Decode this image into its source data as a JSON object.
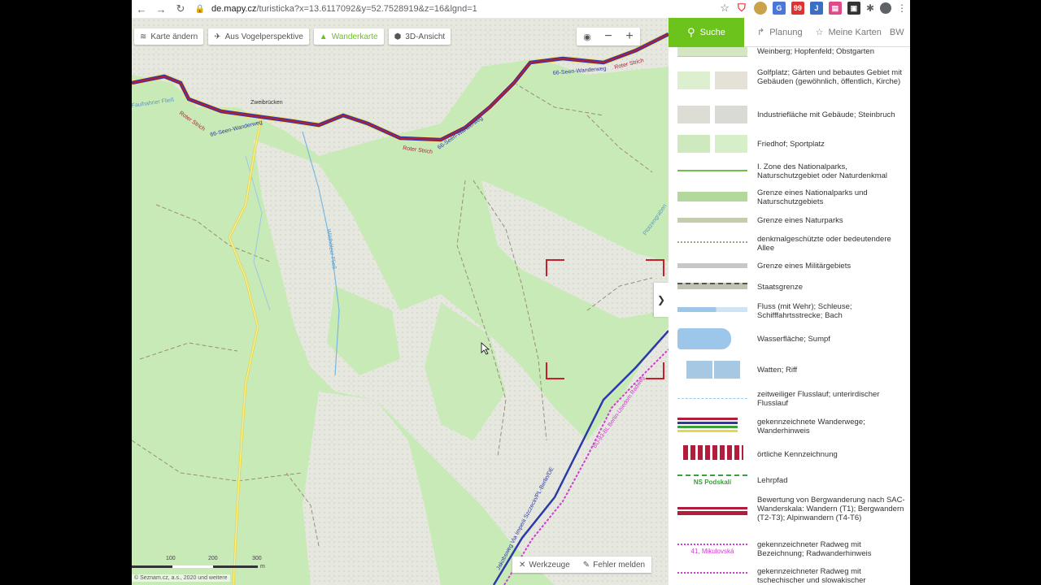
{
  "browser": {
    "url_host": "de.mapy.cz",
    "url_path": "/turisticka?x=13.6117092&y=52.7528919&z=16&lgnd=1"
  },
  "toolbar": {
    "change_map": "Karte ändern",
    "birds_eye": "Aus Vogelperspektive",
    "hiking_map": "Wanderkarte",
    "view_3d": "3D-Ansicht"
  },
  "header": {
    "search": "Suche",
    "planning": "Planung",
    "my_maps": "Meine Karten",
    "user": "BW"
  },
  "map_labels": {
    "village": "Zweibrücken",
    "trail1": "66-Seen-Wanderweg",
    "trail2": "Roter Strich",
    "trail3": "66-Seen-Wanderweg",
    "trail4": "Roter Strich",
    "trail5": "66-Seen-Wanderweg",
    "trail6": "Roter Strich",
    "river1": "Wildhölzer Fließ",
    "river2": "Faulhahner Fließ",
    "road": "Jakobsweg Via Imperii Szczecin/PL-Berlin/DE",
    "bike": "BU-93-BL Berlin-Usedom Radweg",
    "edge": "Plötzengraben"
  },
  "legend": [
    {
      "text": "Weinberg; Hopfenfeld; Obstgarten"
    },
    {
      "text": "Golfplatz; Gärten und bebautes Gebiet mit Gebäuden (gewöhnlich, öffentlich, Kirche)"
    },
    {
      "text": "Industriefläche mit Gebäude; Steinbruch"
    },
    {
      "text": "Friedhof; Sportplatz"
    },
    {
      "text": "I. Zone des Nationalparks, Naturschutzgebiet oder Naturdenkmal"
    },
    {
      "text": "Grenze eines Nationalparks und Naturschutzgebiets"
    },
    {
      "text": "Grenze eines Naturparks"
    },
    {
      "text": "denkmalgeschützte oder bedeutendere Allee"
    },
    {
      "text": "Grenze eines Militärgebiets"
    },
    {
      "text": "Staatsgrenze"
    },
    {
      "text": "Fluss (mit Wehr); Schleuse; Schifffahrtsstrecke; Bach"
    },
    {
      "text": "Wasserfläche; Sumpf"
    },
    {
      "text": "Watten; Riff"
    },
    {
      "text": "zeitweiliger Flusslauf; unterirdischer Flusslauf"
    },
    {
      "text": "gekennzeichnete Wanderwege; Wanderhinweis"
    },
    {
      "text": "örtliche Kennzeichnung"
    },
    {
      "text": "Lehrpfad"
    },
    {
      "text": "Bewertung von Bergwanderung nach SAC-Wanderskala: Wandern (T1); Bergwandern (T2-T3); Alpinwandern (T4-T6)"
    },
    {
      "text": "gekennzeichneter Radweg mit Bezeichnung; Radwanderhinweis"
    },
    {
      "text": "gekennzeichneter Radweg mit tschechischer und slowakischer"
    }
  ],
  "legend_sym_labels": {
    "nature_trail": "NS Podskalí",
    "bike_route": "41, Mikulovská"
  },
  "bottom": {
    "tools": "Werkzeuge",
    "report": "Fehler melden",
    "scale_100": "100",
    "scale_200": "200",
    "scale_300": "300",
    "scale_unit": "m",
    "copyright": "© Seznam.cz, a.s., 2020 und weitere"
  },
  "colors": {
    "accent": "#6cc31c",
    "trail_red": "#b21d3b",
    "trail_blue": "#2b3aa8",
    "bike_magenta": "#d23ad2"
  }
}
